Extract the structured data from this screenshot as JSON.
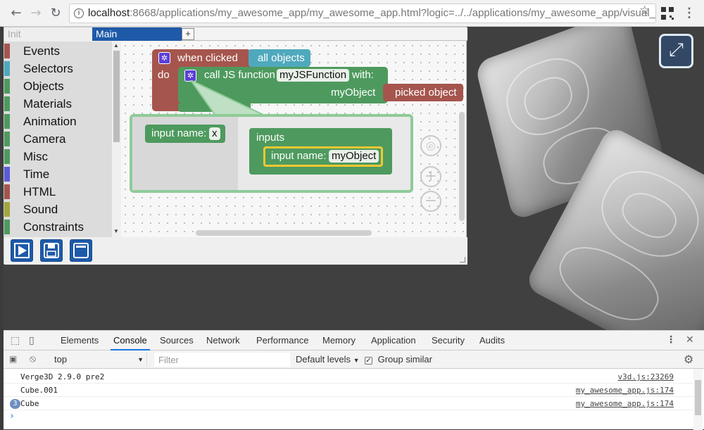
{
  "browser": {
    "url_host": "localhost",
    "url_rest": ":8668/applications/my_awesome_app/my_awesome_app.html?logic=../../applications/my_awesome_app/visual_..."
  },
  "editor": {
    "tabs": {
      "init": "Init",
      "main": "Main",
      "add": "+"
    },
    "categories": [
      {
        "label": "Events",
        "color": "#a5554d"
      },
      {
        "label": "Selectors",
        "color": "#4fa9bd"
      },
      {
        "label": "Objects",
        "color": "#4e9a5e"
      },
      {
        "label": "Materials",
        "color": "#4e9a5e"
      },
      {
        "label": "Animation",
        "color": "#4e9a5e"
      },
      {
        "label": "Camera",
        "color": "#4e9a5e"
      },
      {
        "label": "Misc",
        "color": "#4e9a5e"
      },
      {
        "label": "Time",
        "color": "#5b5bd8"
      },
      {
        "label": "HTML",
        "color": "#a5554d"
      },
      {
        "label": "Sound",
        "color": "#a5a542"
      },
      {
        "label": "Constraints",
        "color": "#4e9a5e"
      }
    ],
    "blocks": {
      "when_clicked": "when clicked",
      "all_objects": "all objects",
      "do": "do",
      "call_js": "call JS function",
      "function_name": "myJSFunction",
      "with": "with:",
      "param_label": "myObject",
      "picked_object": "picked object",
      "input_name": "input name:",
      "input_x": "x",
      "inputs": "inputs",
      "input_name2": "input name:",
      "input_value": "myObject"
    }
  },
  "devtools": {
    "tabs": [
      "Elements",
      "Console",
      "Sources",
      "Network",
      "Performance",
      "Memory",
      "Application",
      "Security",
      "Audits"
    ],
    "active_tab": "Console",
    "context": "top",
    "filter_placeholder": "Filter",
    "levels": "Default levels",
    "group_similar": "Group similar",
    "logs": [
      {
        "message": "Verge3D 2.9.0 pre2",
        "source": "v3d.js:23269",
        "count": ""
      },
      {
        "message": "Cube.001",
        "source": "my_awesome_app.js:174",
        "count": ""
      },
      {
        "message": "Cube",
        "source": "my_awesome_app.js:174",
        "count": "3"
      }
    ],
    "prompt": "›"
  },
  "colors": {
    "brand_blue": "#1e5aa8",
    "event_red": "#a5554d",
    "object_green": "#4e9a5e",
    "selector_teal": "#4fa9bd"
  }
}
